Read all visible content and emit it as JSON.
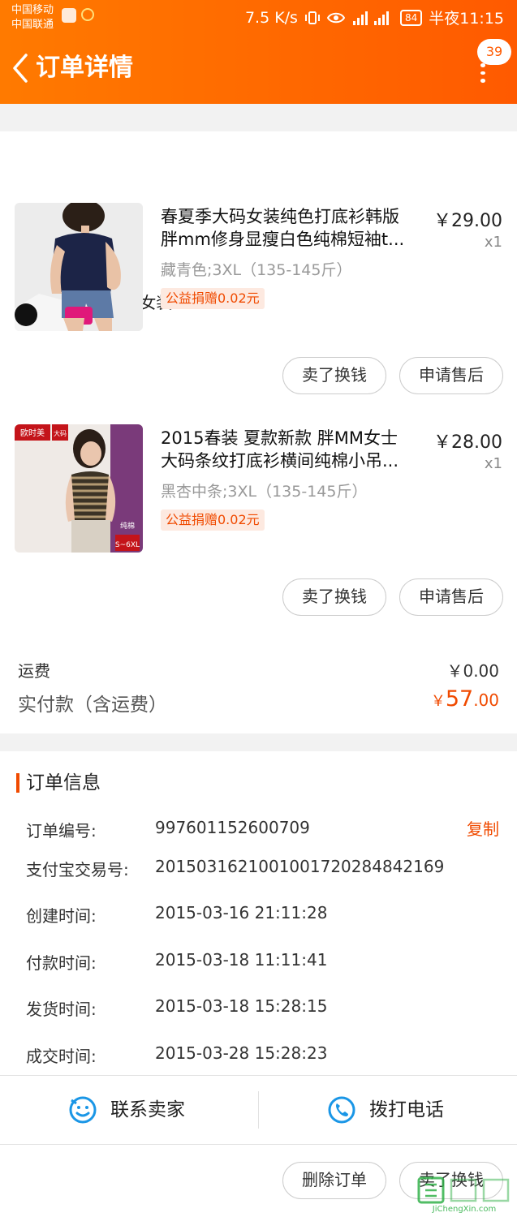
{
  "status_bar": {
    "carrier1": "中国移动",
    "carrier2": "中国联通",
    "speed": "7.5 K/s",
    "signal_text": "2G 4G",
    "battery": "84",
    "time": "半夜11:15"
  },
  "header": {
    "title": "订单详情",
    "badge_count": "39",
    "accent_color": "#ff6600"
  },
  "shop": {
    "name": "欧时美 潮流女装"
  },
  "items": [
    {
      "title_line1": "春夏季大码女装纯色打底衫韩版",
      "title_line2": "胖mm修身显瘦白色纯棉短袖t...",
      "price": "￥29.00",
      "qty": "x1",
      "sku": "藏青色;3XL（135-145斤）",
      "charity": "公益捐赠0.02元",
      "btn_sell": "卖了换钱",
      "btn_after": "申请售后"
    },
    {
      "title_line1": "2015春装 夏款新款 胖MM女士",
      "title_line2": "大码条纹打底衫横间纯棉小吊...",
      "price": "￥28.00",
      "qty": "x1",
      "sku": "黑杏中条;3XL（135-145斤）",
      "charity": "公益捐赠0.02元",
      "btn_sell": "卖了换钱",
      "btn_after": "申请售后",
      "thumb_brand": "欧时美",
      "thumb_tag": "大码",
      "thumb_size": "S~6XL",
      "thumb_cotton": "纯棉"
    }
  ],
  "totals": {
    "shipping_label": "运费",
    "shipping_value": "￥0.00",
    "paid_label": "实付款（含运费）",
    "paid_currency": "￥",
    "paid_int": "57",
    "paid_dec": ".00"
  },
  "order_info": {
    "title": "订单信息",
    "copy_label": "复制",
    "rows": [
      {
        "label": "订单编号:",
        "value": "997601152600709"
      },
      {
        "label": "支付宝交易号:",
        "value": "2015031621001001720284842169"
      },
      {
        "label": "创建时间:",
        "value": "2015-03-16 21:11:28"
      },
      {
        "label": "付款时间:",
        "value": "2015-03-18 11:11:41"
      },
      {
        "label": "发货时间:",
        "value": "2015-03-18 15:28:15"
      },
      {
        "label": "成交时间:",
        "value": "2015-03-28 15:28:23"
      }
    ]
  },
  "actions": {
    "contact_seller": "联系卖家",
    "call_phone": "拨打电话",
    "delete_order": "删除订单",
    "sell_for_cash": "卖了换钱"
  },
  "watermark": {
    "text": "JiChengXin.com"
  }
}
